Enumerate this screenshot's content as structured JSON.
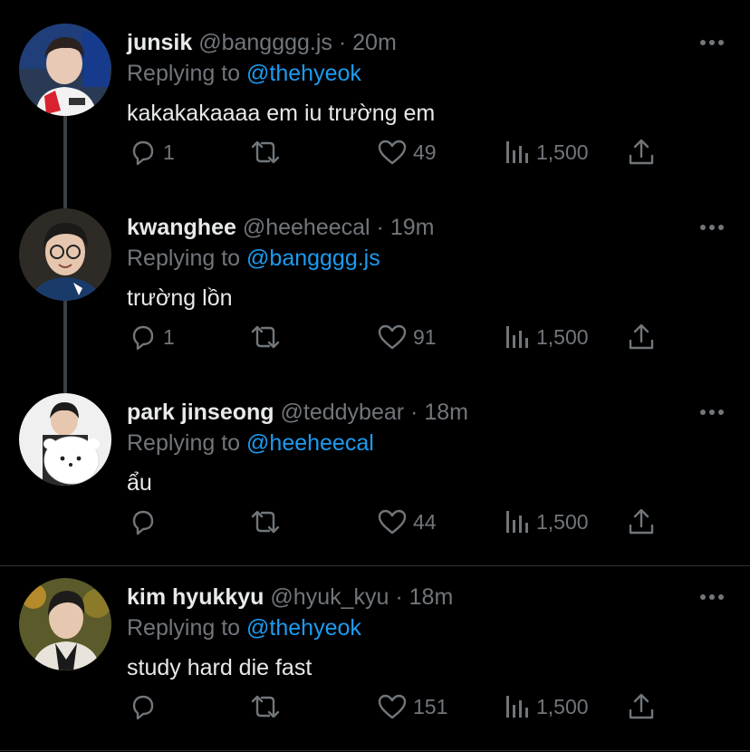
{
  "tweets": [
    {
      "name": "junsik",
      "handle": "@bangggg.js",
      "dot": "·",
      "time": "20m",
      "replying_prefix": "Replying to ",
      "replying_to": "@thehyeok",
      "text": "kakakakaaaa em iu trường em",
      "replies": "1",
      "likes": "49",
      "views": "1,500"
    },
    {
      "name": "kwanghee",
      "handle": "@heeheecal",
      "dot": "·",
      "time": "19m",
      "replying_prefix": "Replying to ",
      "replying_to": "@bangggg.js",
      "text": "trường lồn",
      "replies": "1",
      "likes": "91",
      "views": "1,500"
    },
    {
      "name": "park jinseong",
      "handle": "@teddybear",
      "dot": "·",
      "time": "18m",
      "replying_prefix": "Replying to ",
      "replying_to": "@heeheecal",
      "text": "ẩu",
      "replies": "",
      "likes": "44",
      "views": "1,500"
    },
    {
      "name": "kim hyukkyu",
      "handle": "@hyuk_kyu",
      "dot": "·",
      "time": "18m",
      "replying_prefix": "Replying to ",
      "replying_to": "@thehyeok",
      "text": "study hard die fast",
      "replies": "",
      "likes": "151",
      "views": "1,500"
    }
  ],
  "icons": {
    "more": "more-dots-icon",
    "reply": "reply-bubble-icon",
    "retweet": "retweet-icon",
    "like": "heart-icon",
    "views": "views-bar-chart-icon",
    "share": "share-upload-icon"
  },
  "colors": {
    "background": "#000000",
    "text": "#e7e9ea",
    "muted": "#71767b",
    "link": "#1d9bf0",
    "thread_line": "#3a3f44"
  }
}
